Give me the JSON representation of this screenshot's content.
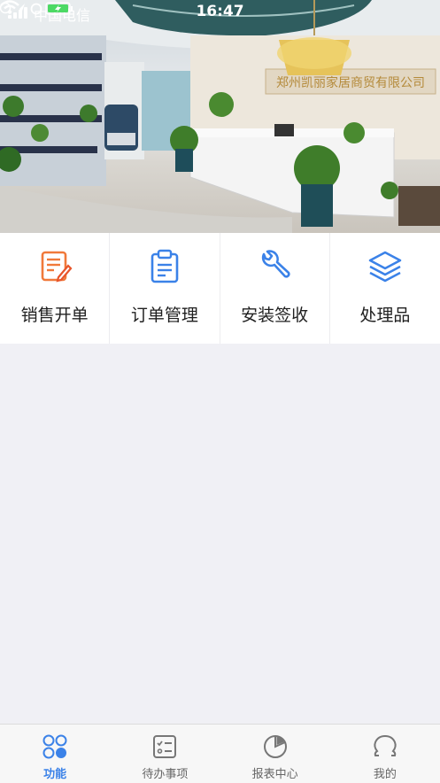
{
  "status_bar": {
    "carrier": "中国电信",
    "time": "16:47"
  },
  "banner": {
    "company_sign": "郑州凯丽家居商贸有限公司"
  },
  "menu": {
    "items": [
      {
        "label": "销售开单",
        "icon": "edit-note-icon",
        "color": "#f0793a"
      },
      {
        "label": "订单管理",
        "icon": "clipboard-icon",
        "color": "#3b82e8"
      },
      {
        "label": "安装签收",
        "icon": "wrench-icon",
        "color": "#3b82e8"
      },
      {
        "label": "处理品",
        "icon": "layers-icon",
        "color": "#3b82e8"
      }
    ]
  },
  "tabbar": {
    "items": [
      {
        "label": "功能",
        "icon": "grid-circles-icon",
        "active": true
      },
      {
        "label": "待办事项",
        "icon": "checklist-icon",
        "active": false
      },
      {
        "label": "报表中心",
        "icon": "pie-chart-icon",
        "active": false
      },
      {
        "label": "我的",
        "icon": "user-icon",
        "active": false
      }
    ],
    "active_color": "#3b82e8",
    "inactive_color": "#777777"
  }
}
